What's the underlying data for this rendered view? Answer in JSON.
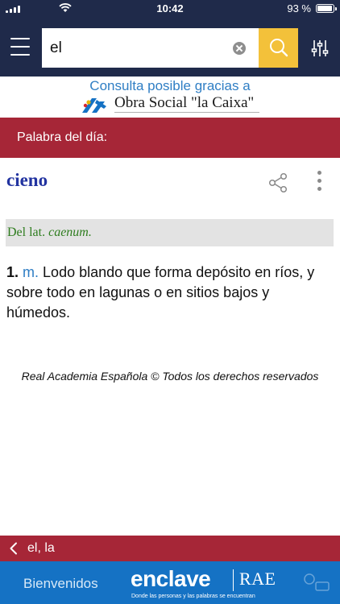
{
  "status_bar": {
    "time": "10:42",
    "battery_percent": "93 %",
    "battery_level": 0.93
  },
  "search": {
    "query": "el"
  },
  "sponsor": {
    "line1": "Consulta posible gracias a",
    "line2": "Obra Social \"la Caixa\""
  },
  "word_of_day": {
    "label": "Palabra del día:",
    "word": "cieno",
    "etymology_prefix": "Del lat. ",
    "etymology_term": "caenum.",
    "definitions": [
      {
        "number": "1.",
        "abbr": "m.",
        "text": "Lodo blando que forma depósito en ríos, y sobre todo en lagunas o en sitios bajos y húmedos."
      }
    ]
  },
  "copyright": "Real Academia Española © Todos los derechos reservados",
  "previous_word": {
    "label": "el, la"
  },
  "ad": {
    "welcome": "Bienvenidos",
    "brand": "enclave",
    "partner": "RAE",
    "tagline": "Donde las personas y las palabras se encuentran"
  },
  "colors": {
    "header": "#1f2a4a",
    "search_button": "#f3c13a",
    "accent_red": "#a62637",
    "headword_blue": "#2233a0",
    "etymology_green": "#2f7d1f",
    "ad_blue": "#1572c4"
  },
  "icons": {
    "menu": "hamburger-icon",
    "clear": "clear-icon",
    "search": "search-icon",
    "filter": "sliders-icon",
    "share": "share-icon",
    "more": "more-vertical-icon",
    "back": "chevron-left-icon",
    "sponsor": "caixa-star-icon"
  }
}
